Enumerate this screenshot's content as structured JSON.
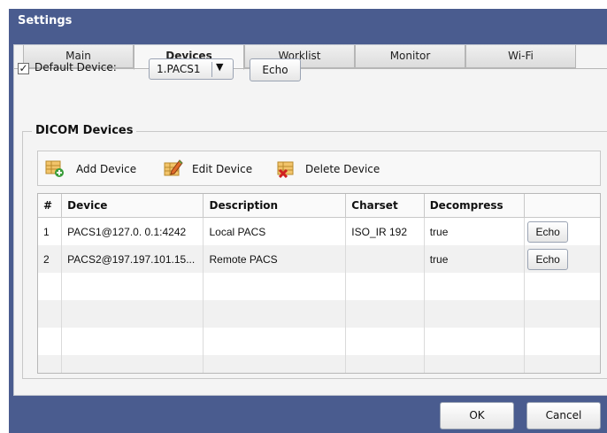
{
  "window": {
    "title": "Settings"
  },
  "tabs": [
    {
      "label": "Main",
      "active": false
    },
    {
      "label": "Devices",
      "active": true
    },
    {
      "label": "Worklist",
      "active": false
    },
    {
      "label": "Monitor",
      "active": false
    },
    {
      "label": "Wi-Fi",
      "active": false
    }
  ],
  "default_device": {
    "checked": true,
    "check_mark": "✓",
    "label": "Default Device:",
    "selected": "1.PACS1",
    "arrow": "▼",
    "echo_label": "Echo"
  },
  "dicom": {
    "group_label": "DICOM Devices",
    "toolbar": {
      "add_label": "Add Device",
      "edit_label": "Edit Device",
      "delete_label": "Delete Device"
    },
    "columns": [
      "#",
      "Device",
      "Description",
      "Charset",
      "Decompress",
      ""
    ],
    "rows": [
      {
        "num": "1",
        "device": "PACS1@127.0. 0.1:4242",
        "description": "Local PACS",
        "charset": "ISO_IR 192",
        "decompress": "true",
        "echo": "Echo"
      },
      {
        "num": "2",
        "device": "PACS2@197.197.101.15...",
        "description": "Remote PACS",
        "charset": "",
        "decompress": "true",
        "echo": "Echo"
      }
    ]
  },
  "footer": {
    "ok_label": "OK",
    "cancel_label": "Cancel"
  },
  "colors": {
    "frame": "#4a5c8f",
    "panel": "#f4f4f4"
  },
  "icons": [
    "add-device-icon",
    "edit-device-icon",
    "delete-device-icon",
    "checkbox-check-icon",
    "dropdown-arrow-icon"
  ]
}
